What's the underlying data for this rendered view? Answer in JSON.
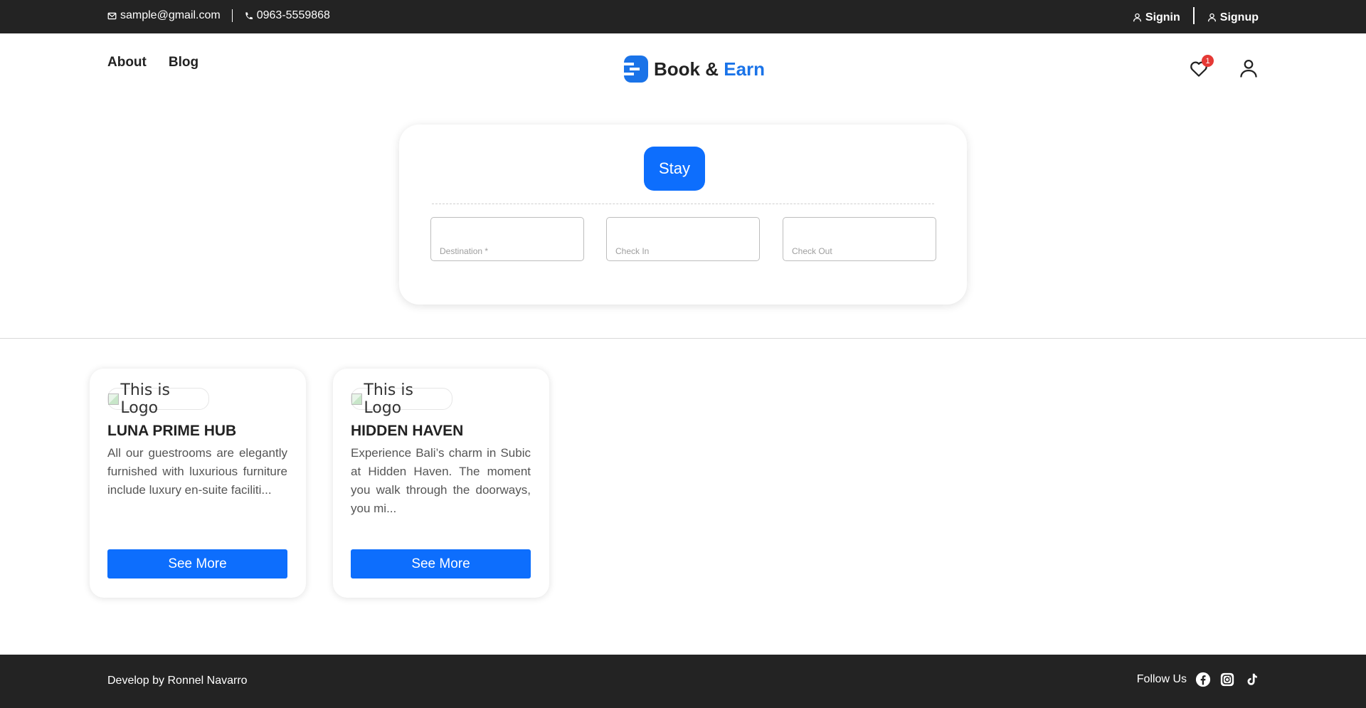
{
  "topbar": {
    "email": "sample@gmail.com",
    "phone": "0963-5559868",
    "signin": "Signin",
    "signup": "Signup"
  },
  "nav": {
    "about": "About",
    "blog": "Blog"
  },
  "brand": {
    "part1": "Book &",
    "part2": "Earn",
    "accent_color": "#1a73e8"
  },
  "header": {
    "wishlist_count": "1"
  },
  "search": {
    "tab_label": "Stay",
    "destination_placeholder": "Destination *",
    "checkin_placeholder": "Check In",
    "checkout_placeholder": "Check Out"
  },
  "listings": [
    {
      "logo_alt": "This is Logo",
      "title": "LUNA PRIME HUB",
      "description": "All our guestrooms are elegantly furnished with luxurious furniture include luxury en-suite faciliti...",
      "button": "See More"
    },
    {
      "logo_alt": "This is Logo",
      "title": "HIDDEN HAVEN",
      "description": "Experience Bali’s charm in Subic at Hidden Haven. The moment you walk through the doorways, you mi...",
      "button": "See More"
    }
  ],
  "footer": {
    "credit": "Develop by Ronnel Navarro",
    "follow_label": "Follow Us",
    "socials": [
      "facebook-icon",
      "instagram-icon",
      "tiktok-icon"
    ]
  },
  "colors": {
    "primary": "#0d6efd",
    "dark_bar": "#232323",
    "badge": "#e53935"
  }
}
